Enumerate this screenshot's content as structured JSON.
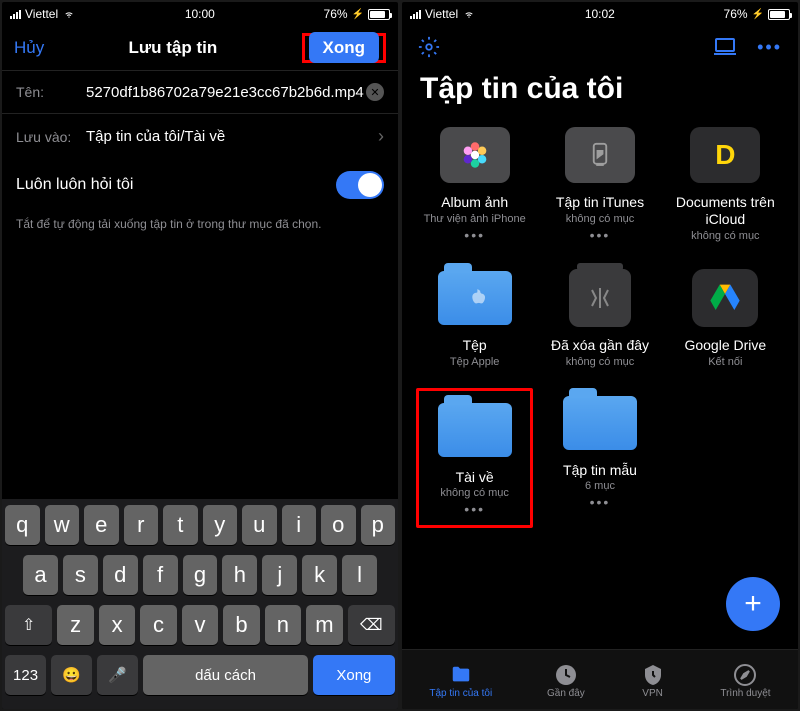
{
  "left": {
    "status": {
      "carrier": "Viettel",
      "time": "10:00",
      "battery_pct": "76%"
    },
    "nav": {
      "cancel": "Hủy",
      "title": "Lưu tập tin",
      "done": "Xong"
    },
    "name_label": "Tên:",
    "name_value": "5270df1b86702a79e21e3cc67b2b6d.mp4",
    "save_label": "Lưu vào:",
    "save_value": "Tập tin của tôi/Tài về",
    "toggle_label": "Luôn luôn hỏi tôi",
    "hint": "Tắt để tự động tải xuống tập tin ở trong thư mục đã chọn.",
    "keyboard": {
      "row1": [
        "q",
        "w",
        "e",
        "r",
        "t",
        "y",
        "u",
        "i",
        "o",
        "p"
      ],
      "row2": [
        "a",
        "s",
        "d",
        "f",
        "g",
        "h",
        "j",
        "k",
        "l"
      ],
      "row3_shift": "⇧",
      "row3": [
        "z",
        "x",
        "c",
        "v",
        "b",
        "n",
        "m"
      ],
      "row3_del": "⌫",
      "k123": "123",
      "emoji": "😀",
      "mic": "🎤",
      "space": "dấu cách",
      "primary": "Xong"
    }
  },
  "right": {
    "status": {
      "carrier": "Viettel",
      "time": "10:02",
      "battery_pct": "76%"
    },
    "title": "Tập tin của tôi",
    "items": [
      {
        "title": "Album ảnh",
        "sub": "Thư viện ảnh iPhone",
        "icon": "photos",
        "dots": "•••"
      },
      {
        "title": "Tập tin iTunes",
        "sub": "không có mục",
        "icon": "itunes",
        "dots": "•••"
      },
      {
        "title": "Documents trên iCloud",
        "sub": "không có mục",
        "icon": "docs-icloud",
        "dots": ""
      },
      {
        "title": "Tệp",
        "sub": "Tệp Apple",
        "icon": "apple-folder",
        "dots": ""
      },
      {
        "title": "Đã xóa gần đây",
        "sub": "không có mục",
        "icon": "trash",
        "dots": ""
      },
      {
        "title": "Google Drive",
        "sub": "Kết nối",
        "icon": "gdrive",
        "dots": ""
      },
      {
        "title": "Tài về",
        "sub": "không có mục",
        "icon": "downloads",
        "dots": "•••"
      },
      {
        "title": "Tập tin mẫu",
        "sub": "6 mục",
        "icon": "folder",
        "dots": "•••"
      }
    ],
    "tabs": [
      {
        "label": "Tập tin của tôi",
        "icon": "folder",
        "active": true
      },
      {
        "label": "Gần đây",
        "icon": "clock",
        "active": false
      },
      {
        "label": "VPN",
        "icon": "vpn",
        "active": false
      },
      {
        "label": "Trình duyệt",
        "icon": "compass",
        "active": false
      }
    ]
  }
}
